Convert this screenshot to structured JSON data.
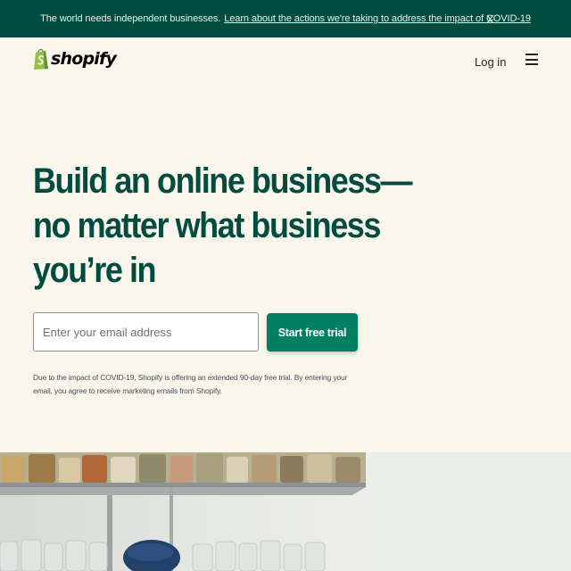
{
  "banner": {
    "message": "The world needs independent businesses.",
    "link_text": "Learn about the actions we're taking to address the impact of COVID-19",
    "close_label": "X"
  },
  "header": {
    "logo_text": "shopify",
    "login_label": "Log in",
    "menu_icon": "hamburger-menu-icon"
  },
  "hero": {
    "title_lines": [
      "Build an online business—",
      "no matter what business",
      "you’re in"
    ],
    "email_placeholder": "Enter your email address",
    "email_value": "",
    "cta_label": "Start free trial",
    "disclaimer": "Due to the impact of COVID-19, Shopify is offering an extended 90-day free trial. By entering your email, you agree to receive marketing emails from Shopify."
  },
  "colors": {
    "banner_bg": "#004c3f",
    "page_bg": "#fbf7ed",
    "heading": "#004c3f",
    "cta_bg": "#008060",
    "logo_green": "#95bf47"
  }
}
